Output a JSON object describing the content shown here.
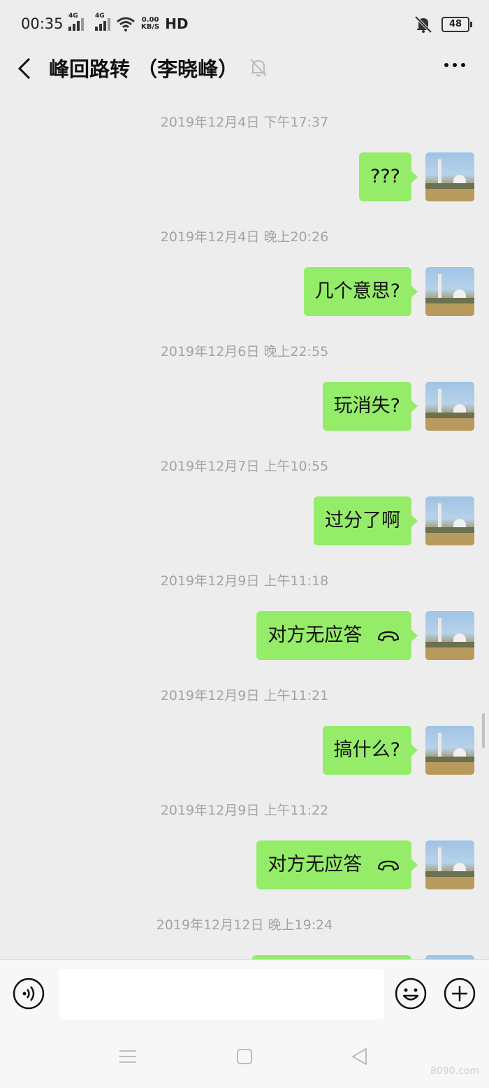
{
  "status_bar": {
    "time": "00:35",
    "sim1": "4G",
    "sim2": "4G",
    "net_speed_value": "0.00",
    "net_speed_unit": "KB/S",
    "hd": "HD",
    "battery": "48",
    "icons": [
      "signal-icon",
      "signal-icon",
      "wifi-icon",
      "bell-off-icon",
      "battery-icon"
    ]
  },
  "header": {
    "title": "峰回路转 （李晓峰）",
    "icons": [
      "back-icon",
      "mute-icon",
      "more-icon"
    ]
  },
  "messages": [
    {
      "timestamp": "2019年12月4日 下午17:37",
      "text": "???",
      "call": false
    },
    {
      "timestamp": "2019年12月4日 晚上20:26",
      "text": "几个意思?",
      "call": false
    },
    {
      "timestamp": "2019年12月6日 晚上22:55",
      "text": "玩消失?",
      "call": false
    },
    {
      "timestamp": "2019年12月7日 上午10:55",
      "text": "过分了啊",
      "call": false
    },
    {
      "timestamp": "2019年12月9日 上午11:18",
      "text": "对方无应答",
      "call": true
    },
    {
      "timestamp": "2019年12月9日 上午11:21",
      "text": "搞什么?",
      "call": false
    },
    {
      "timestamp": "2019年12月9日 上午11:22",
      "text": "对方无应答",
      "call": true
    },
    {
      "timestamp": "2019年12月12日 晚上19:24",
      "text": "",
      "call": false
    }
  ],
  "input_bar": {
    "icons": [
      "voice-icon",
      "emoji-icon",
      "plus-icon"
    ],
    "value": ""
  },
  "nav_bar": {
    "icons": [
      "menu-icon",
      "home-icon",
      "back-triangle-icon"
    ],
    "watermark": "8090.com"
  },
  "colors": {
    "bubble": "#95ec69",
    "background": "#ededed",
    "timestamp": "#a3a3a3"
  }
}
